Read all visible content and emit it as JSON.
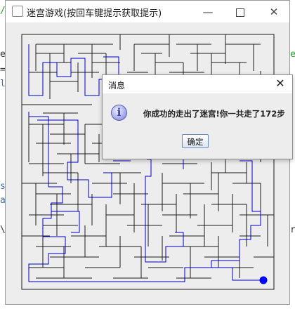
{
  "window": {
    "title": "迷宫游戏(按回车键提示获取提示)",
    "controls": {
      "minimize": "—",
      "close": "✕"
    }
  },
  "dialog": {
    "title": "消息",
    "close_glyph": "✕",
    "message": "你成功的走出了迷宫!你一共走了172步",
    "ok_label": "确定",
    "icon": "info-icon"
  },
  "colors": {
    "path": "#0000c0",
    "walls": "#1a1a1a",
    "player": "#0000ff"
  }
}
